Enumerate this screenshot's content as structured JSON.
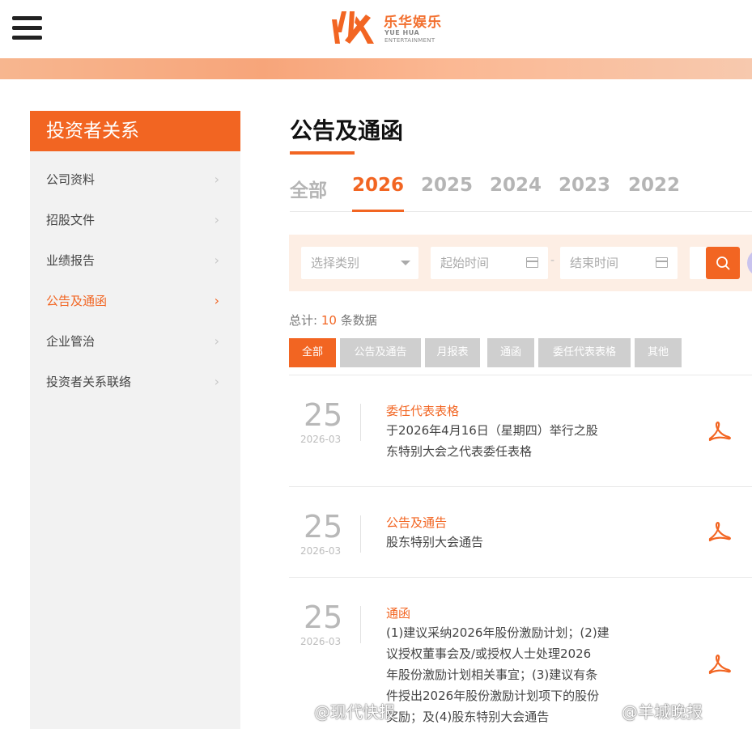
{
  "header": {
    "logo_cn": "乐华娱乐",
    "logo_en_line1": "YUE HUA",
    "logo_en_line2": "ENTERTAINMENT"
  },
  "sidebar": {
    "title": "投资者关系",
    "items": [
      {
        "label": "公司资料",
        "active": false
      },
      {
        "label": "招股文件",
        "active": false
      },
      {
        "label": "业绩报告",
        "active": false
      },
      {
        "label": "公告及通函",
        "active": true
      },
      {
        "label": "企业管治",
        "active": false
      },
      {
        "label": "投资者关系联络",
        "active": false
      }
    ]
  },
  "main": {
    "title": "公告及通函",
    "year_tabs": [
      "全部",
      "2026",
      "2025",
      "2024",
      "2023",
      "2022"
    ],
    "active_year": "2026",
    "filters": {
      "category_placeholder": "选择类别",
      "start_placeholder": "起始时间",
      "dash": "-",
      "end_placeholder": "结束时间"
    },
    "total": {
      "prefix": "总计:",
      "count": "10",
      "suffix": "条数据"
    },
    "category_tabs": [
      "全部",
      "公告及通告",
      "月报表",
      "通函",
      "委任代表表格",
      "其他"
    ],
    "active_category": "全部",
    "items": [
      {
        "day": "25",
        "year_month": "2026-03",
        "type": "委任代表表格",
        "lines": [
          "于2026年4月16日（星期四）举行之股",
          "东特别大会之代表委任表格"
        ]
      },
      {
        "day": "25",
        "year_month": "2026-03",
        "type": "公告及通告",
        "lines": [
          "股东特别大会通告"
        ]
      },
      {
        "day": "25",
        "year_month": "2026-03",
        "type": "通函",
        "lines": [
          "(1)建议采纳2026年股份激励计划；(2)建",
          "议授权董事会及/或授权人士处理2026",
          "年股份激励计划相关事宜；(3)建议有条",
          "件授出2026年股份激励计划项下的股份",
          "奖励；及(4)股东特别大会通告"
        ]
      }
    ]
  },
  "watermarks": [
    "@现代快报",
    "@羊城晚报"
  ],
  "colors": {
    "accent": "#f26522",
    "sidebar_bg": "#f2f2f2",
    "filter_bg": "#fdeee4"
  }
}
